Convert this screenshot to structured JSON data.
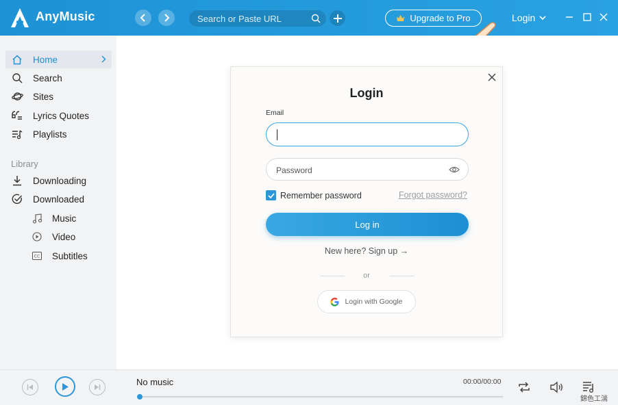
{
  "app": {
    "name": "AnyMusic",
    "accent": "#1d93d6"
  },
  "titlebar": {
    "search_placeholder": "Search or Paste URL",
    "upgrade_label": "Upgrade to Pro",
    "login_label": "Login"
  },
  "sidebar": {
    "items": [
      {
        "label": "Home",
        "icon": "home-icon"
      },
      {
        "label": "Search",
        "icon": "search-icon"
      },
      {
        "label": "Sites",
        "icon": "planet-icon"
      },
      {
        "label": "Lyrics Quotes",
        "icon": "quote-icon"
      },
      {
        "label": "Playlists",
        "icon": "playlist-icon"
      }
    ],
    "library_header": "Library",
    "library_items": [
      {
        "label": "Downloading",
        "icon": "download-icon"
      },
      {
        "label": "Downloaded",
        "icon": "check-circle-icon"
      }
    ],
    "sub_items": [
      {
        "label": "Music",
        "icon": "music-note-icon"
      },
      {
        "label": "Video",
        "icon": "play-circle-icon"
      },
      {
        "label": "Subtitles",
        "icon": "cc-icon"
      }
    ]
  },
  "dialog": {
    "title": "Login",
    "email_label": "Email",
    "email_value": "",
    "password_placeholder": "Password",
    "remember_label": "Remember password",
    "remember_checked": true,
    "forgot_label": "Forgot password?",
    "login_button": "Log in",
    "signup_text": "New here? Sign up →",
    "or_text": "or",
    "google_button": "Login with Google"
  },
  "player": {
    "now_playing": "No music",
    "time": "00:00/00:00"
  },
  "watermark": "錦色工湍"
}
